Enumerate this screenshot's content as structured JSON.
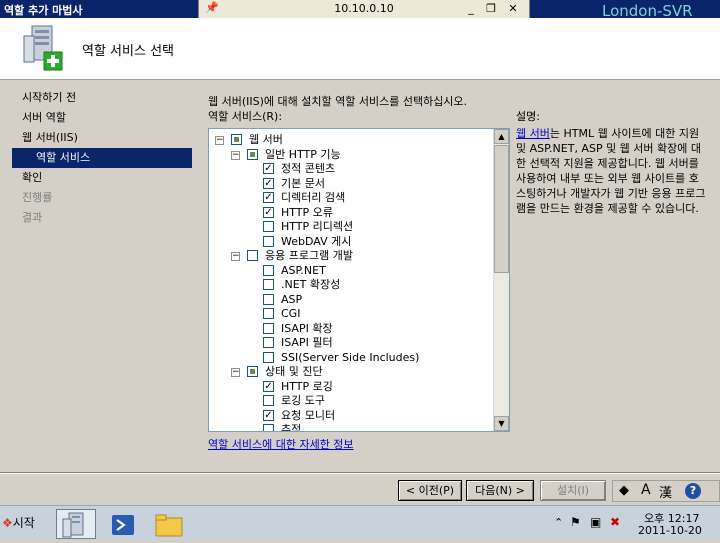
{
  "window": {
    "title": "역할 추가 마법사"
  },
  "rdp": {
    "host": "10.10.0.10",
    "server_name": "London-SVR"
  },
  "header": {
    "title": "역할 서비스 선택"
  },
  "nav": [
    {
      "label": "시작하기 전",
      "state": "normal"
    },
    {
      "label": "서버 역할",
      "state": "normal"
    },
    {
      "label": "웹 서버(IIS)",
      "state": "normal"
    },
    {
      "label": "역할 서비스",
      "state": "selected"
    },
    {
      "label": "확인",
      "state": "normal"
    },
    {
      "label": "진행률",
      "state": "disabled"
    },
    {
      "label": "결과",
      "state": "disabled"
    }
  ],
  "main": {
    "instruction": "웹 서버(IIS)에 대해 설치할 역할 서비스를 선택하십시오.",
    "services_label": "역할 서비스(R):",
    "more_info_link": "역할 서비스에 대한 자세한 정보"
  },
  "tree": [
    {
      "label": "웹 서버",
      "level": 0,
      "state": "partial",
      "expander": "−"
    },
    {
      "label": "일반 HTTP 기능",
      "level": 1,
      "state": "partial",
      "expander": "−"
    },
    {
      "label": "정적 콘텐츠",
      "level": 2,
      "state": "checked"
    },
    {
      "label": "기본 문서",
      "level": 2,
      "state": "checked"
    },
    {
      "label": "디렉터리 검색",
      "level": 2,
      "state": "checked"
    },
    {
      "label": "HTTP 오류",
      "level": 2,
      "state": "checked"
    },
    {
      "label": "HTTP 리디렉션",
      "level": 2,
      "state": "unchecked"
    },
    {
      "label": "WebDAV 게시",
      "level": 2,
      "state": "unchecked"
    },
    {
      "label": "응용 프로그램 개발",
      "level": 1,
      "state": "unchecked",
      "expander": "−"
    },
    {
      "label": "ASP.NET",
      "level": 2,
      "state": "unchecked"
    },
    {
      "label": ".NET 확장성",
      "level": 2,
      "state": "unchecked"
    },
    {
      "label": "ASP",
      "level": 2,
      "state": "unchecked"
    },
    {
      "label": "CGI",
      "level": 2,
      "state": "unchecked"
    },
    {
      "label": "ISAPI 확장",
      "level": 2,
      "state": "unchecked"
    },
    {
      "label": "ISAPI 필터",
      "level": 2,
      "state": "unchecked"
    },
    {
      "label": "SSI(Server Side Includes)",
      "level": 2,
      "state": "unchecked"
    },
    {
      "label": "상태 및 진단",
      "level": 1,
      "state": "partial",
      "expander": "−"
    },
    {
      "label": "HTTP 로깅",
      "level": 2,
      "state": "checked"
    },
    {
      "label": "로깅 도구",
      "level": 2,
      "state": "unchecked"
    },
    {
      "label": "요청 모니터",
      "level": 2,
      "state": "checked"
    },
    {
      "label": "추적",
      "level": 2,
      "state": "unchecked"
    }
  ],
  "description": {
    "label": "설명:",
    "link": "웹 서버",
    "text": "는 HTML 웹 사이트에 대한 지원 및 ASP.NET, ASP 및 웹 서버 확장에 대한 선택적 지원을 제공합니다. 웹 서버를 사용하여 내부 또는 외부 웹 사이트를 호스팅하거나 개발자가 웹 기반 응용 프로그램을 만드는 환경을 제공할 수 있습니다."
  },
  "buttons": {
    "back": "< 이전(P)",
    "next": "다음(N) >",
    "install": "설치(I)"
  },
  "taskbar": {
    "start": "시작",
    "time": "오후 12:17",
    "date": "2011-10-20"
  },
  "icons": {
    "pin": "pushpin-icon",
    "header": "server-add-icon",
    "ie": "ie-icon",
    "powershell": "powershell-icon",
    "explorer": "folder-icon",
    "help": "help-icon"
  },
  "colors": {
    "selection": "#0a246a",
    "link": "#0000cc",
    "title_bar": "#0a246a"
  }
}
